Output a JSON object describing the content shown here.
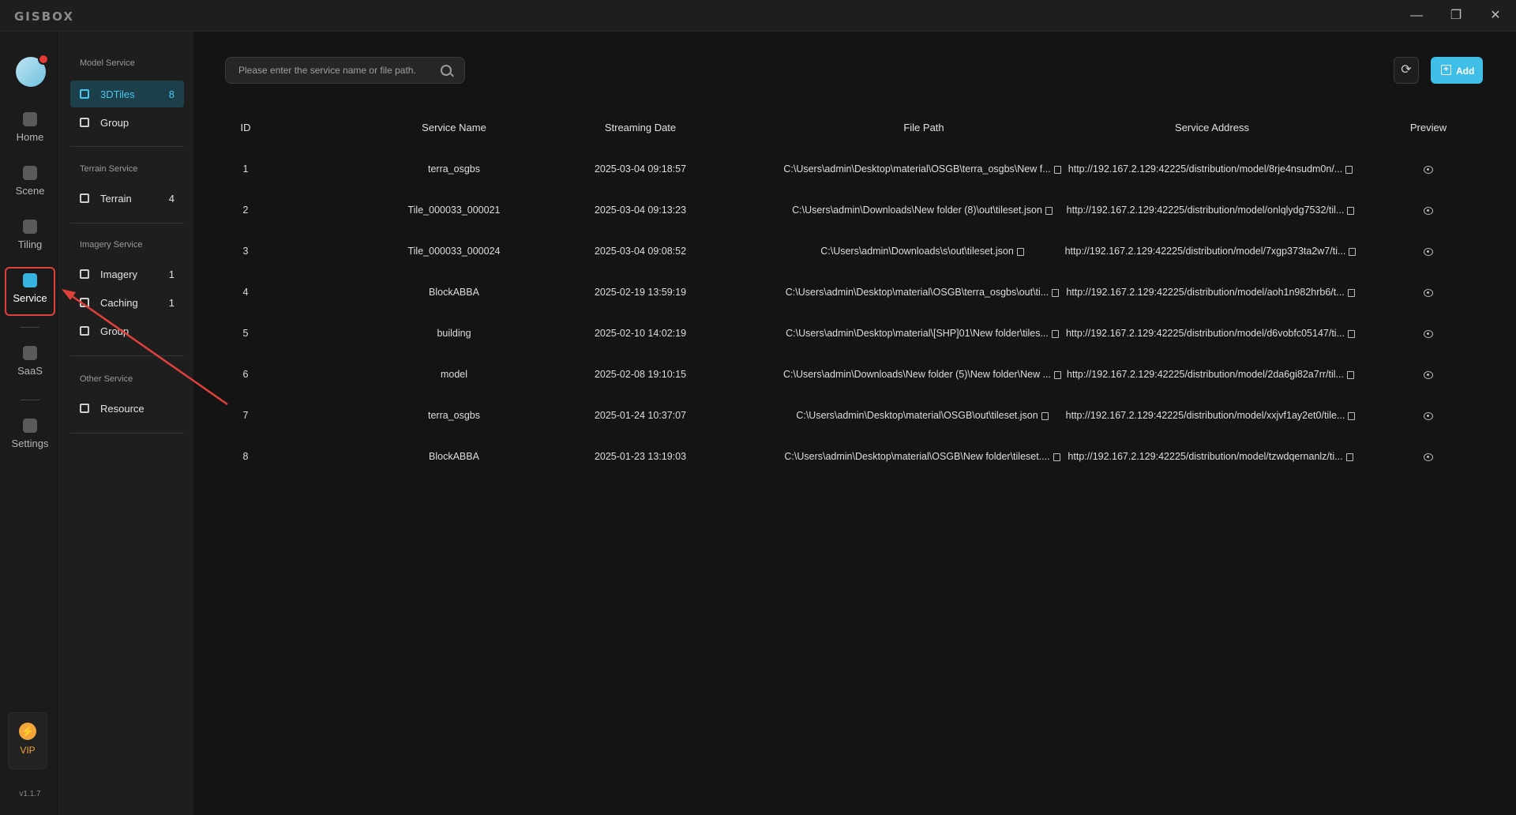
{
  "app": {
    "logo": "GISBOX",
    "version": "v1.1.7"
  },
  "window": {
    "minimize": "—",
    "maximize": "❐",
    "close": "✕"
  },
  "nav": {
    "items": [
      {
        "label": "Home",
        "icon": "home-icon"
      },
      {
        "label": "Scene",
        "icon": "scene-icon"
      },
      {
        "label": "Tiling",
        "icon": "tiling-icon"
      },
      {
        "label": "Service",
        "icon": "service-icon",
        "active": true
      },
      {
        "label": "SaaS",
        "icon": "saas-icon"
      },
      {
        "label": "Settings",
        "icon": "settings-icon"
      }
    ],
    "vip": {
      "label": "VIP",
      "icon": "⚡"
    }
  },
  "categories": {
    "model": {
      "title": "Model Service",
      "items": [
        {
          "label": "3DTiles",
          "count": "8"
        },
        {
          "label": "Group",
          "count": ""
        }
      ]
    },
    "terrain": {
      "title": "Terrain Service",
      "items": [
        {
          "label": "Terrain",
          "count": "4"
        }
      ]
    },
    "imagery": {
      "title": "Imagery Service",
      "items": [
        {
          "label": "Imagery",
          "count": "1"
        },
        {
          "label": "Caching",
          "count": "1"
        },
        {
          "label": "Group",
          "count": ""
        }
      ]
    },
    "other": {
      "title": "Other Service",
      "items": [
        {
          "label": "Resource",
          "count": ""
        }
      ]
    }
  },
  "toolbar": {
    "search_placeholder": "Please enter the service name or file path.",
    "refresh_icon": "⟳",
    "add_label": "Add",
    "add_icon": "+"
  },
  "table": {
    "columns": [
      "ID",
      "Service Name",
      "Streaming Date",
      "File Path",
      "Service Address",
      "Preview"
    ],
    "rows": [
      {
        "id": "1",
        "name": "terra_osgbs",
        "date": "2025-03-04 09:18:57",
        "path": "C:\\Users\\admin\\Desktop\\material\\OSGB\\terra_osgbs\\New f...",
        "address": "http://192.167.2.129:42225/distribution/model/8rje4nsudm0n/..."
      },
      {
        "id": "2",
        "name": "Tile_000033_000021",
        "date": "2025-03-04 09:13:23",
        "path": "C:\\Users\\admin\\Downloads\\New folder (8)\\out\\tileset.json",
        "address": "http://192.167.2.129:42225/distribution/model/onlqlydg7532/til..."
      },
      {
        "id": "3",
        "name": "Tile_000033_000024",
        "date": "2025-03-04 09:08:52",
        "path": "C:\\Users\\admin\\Downloads\\s\\out\\tileset.json",
        "address": "http://192.167.2.129:42225/distribution/model/7xgp373ta2w7/ti..."
      },
      {
        "id": "4",
        "name": "BlockABBA",
        "date": "2025-02-19 13:59:19",
        "path": "C:\\Users\\admin\\Desktop\\material\\OSGB\\terra_osgbs\\out\\ti...",
        "address": "http://192.167.2.129:42225/distribution/model/aoh1n982hrb6/t..."
      },
      {
        "id": "5",
        "name": "building",
        "date": "2025-02-10 14:02:19",
        "path": "C:\\Users\\admin\\Desktop\\material\\[SHP]01\\New folder\\tiles...",
        "address": "http://192.167.2.129:42225/distribution/model/d6vobfc05147/ti..."
      },
      {
        "id": "6",
        "name": "model",
        "date": "2025-02-08 19:10:15",
        "path": "C:\\Users\\admin\\Downloads\\New folder (5)\\New folder\\New ...",
        "address": "http://192.167.2.129:42225/distribution/model/2da6gi82a7rr/til..."
      },
      {
        "id": "7",
        "name": "terra_osgbs",
        "date": "2025-01-24 10:37:07",
        "path": "C:\\Users\\admin\\Desktop\\material\\OSGB\\out\\tileset.json",
        "address": "http://192.167.2.129:42225/distribution/model/xxjvf1ay2et0/tile..."
      },
      {
        "id": "8",
        "name": "BlockABBA",
        "date": "2025-01-23 13:19:03",
        "path": "C:\\Users\\admin\\Desktop\\material\\OSGB\\New folder\\tileset....",
        "address": "http://192.167.2.129:42225/distribution/model/tzwdqernanlz/ti..."
      }
    ]
  },
  "colors": {
    "accent": "#3fbfe8",
    "active_bg": "#1d3f4a",
    "highlight": "#e0413a",
    "vip": "#f2a53a"
  }
}
